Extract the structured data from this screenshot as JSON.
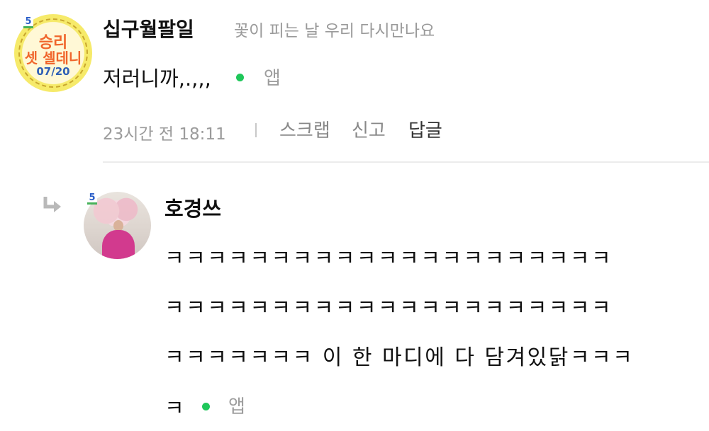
{
  "comment": {
    "avatar": {
      "badge": "5",
      "line1": "승리",
      "line2": "셋 셀데니",
      "line3": "07/20"
    },
    "nickname": "십구월팔일",
    "subtitle": "꽃이 피는 날 우리 다시만나요",
    "text": "저러니까,.,,,",
    "app_label": "앱",
    "time": "23시간 전 18:11",
    "actions": {
      "scrap": "스크랩",
      "report": "신고",
      "reply": "답글"
    }
  },
  "reply": {
    "avatar": {
      "badge": "5"
    },
    "nickname": "호경쓰",
    "lines": [
      "ㅋㅋㅋㅋㅋㅋㅋㅋㅋㅋㅋㅋㅋㅋㅋㅋㅋㅋㅋㅋㅋ",
      "ㅋㅋㅋㅋㅋㅋㅋㅋㅋㅋㅋㅋㅋㅋㅋㅋㅋㅋㅋㅋㅋ",
      "ㅋㅋㅋㅋㅋㅋㅋ 이 한 마디에 다 담겨있닭ㅋㅋㅋ",
      "ㅋ"
    ],
    "app_label": "앱"
  },
  "colors": {
    "app_dot": "#1fc75a",
    "badge_text": "#2a5ec8",
    "badge_underline": "#47b25a",
    "meta_gray": "#9b9b9b"
  },
  "icons": [
    "reply-arrow-icon",
    "app-dot-icon",
    "site-badge-icon"
  ]
}
